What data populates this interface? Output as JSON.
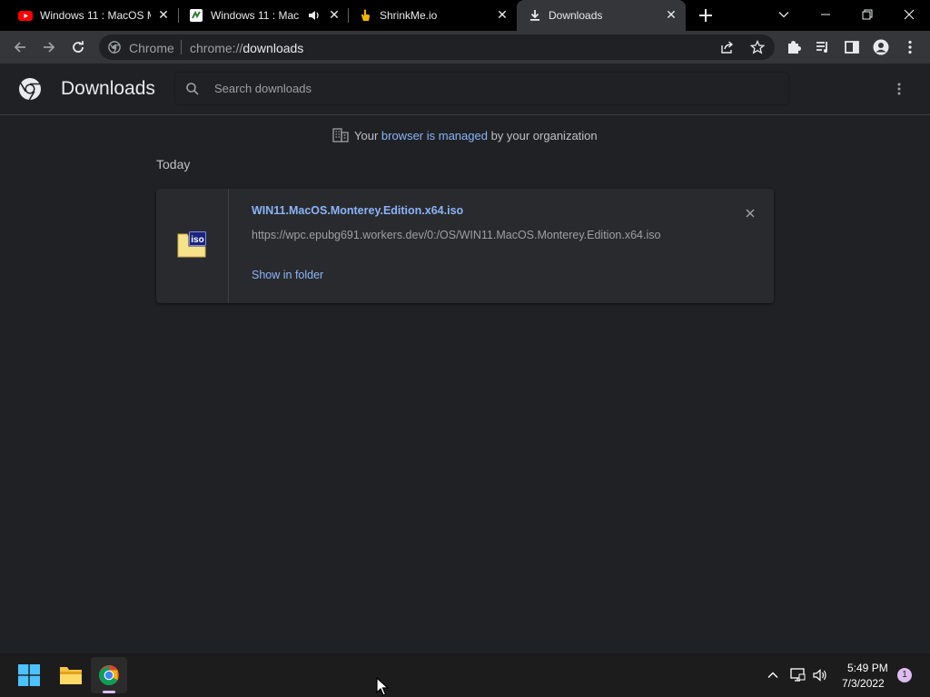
{
  "tabs": [
    {
      "label": "Windows 11 : MacOS M",
      "icon": "youtube-icon"
    },
    {
      "label": "Windows 11 : Mac",
      "icon": "site-icon"
    },
    {
      "label": "ShrinkMe.io",
      "icon": "hand-icon"
    },
    {
      "label": "Downloads",
      "icon": "download-icon",
      "active": true
    }
  ],
  "omnibox": {
    "site_label": "Chrome",
    "url_prefix": "chrome://",
    "url_path": "downloads"
  },
  "page": {
    "title": "Downloads",
    "search_placeholder": "Search downloads"
  },
  "managed": {
    "prefix": "Your ",
    "link": "browser is managed",
    "suffix": " by your organization"
  },
  "section": {
    "date": "Today"
  },
  "download": {
    "filename": "WIN11.MacOS.Monterey.Edition.x64.iso",
    "url": "https://wpc.epubg691.workers.dev/0:/OS/WIN11.MacOS.Monterey.Edition.x64.iso",
    "action": "Show in folder",
    "file_badge": "iso"
  },
  "taskbar": {
    "time": "5:49 PM",
    "date": "7/3/2022",
    "notifications": "1"
  },
  "colors": {
    "accent": "#8ab4f8",
    "background": "#202124",
    "toolbar": "#35363a"
  }
}
